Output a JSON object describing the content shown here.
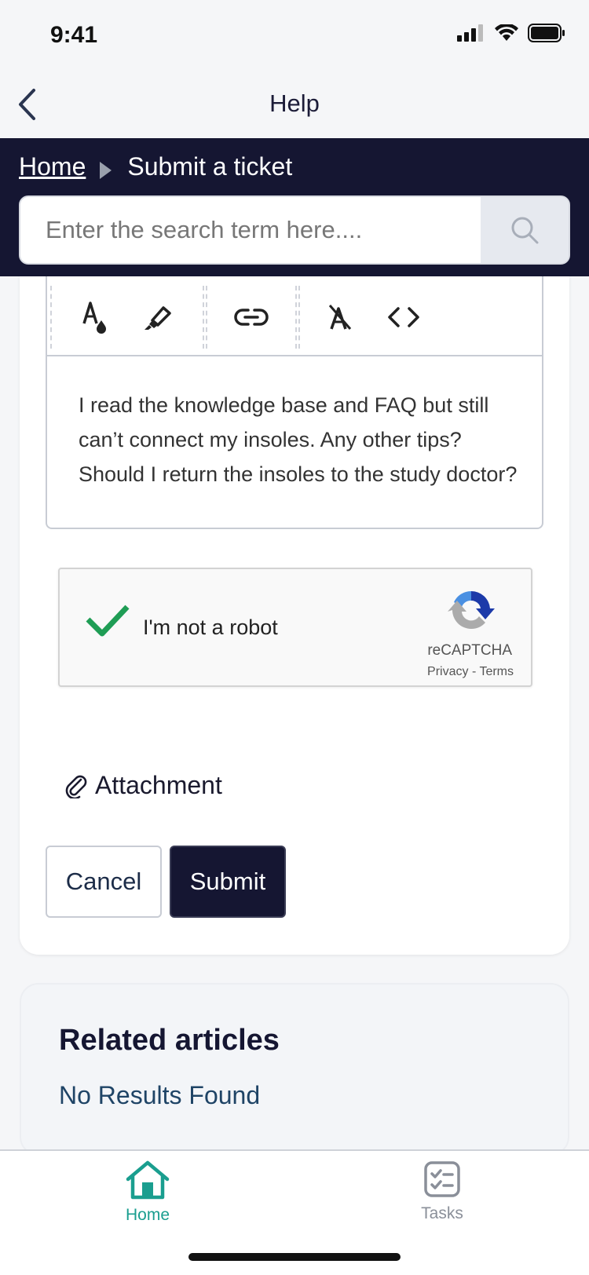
{
  "status_bar": {
    "time": "9:41"
  },
  "nav": {
    "title": "Help"
  },
  "breadcrumb": {
    "home": "Home",
    "current": "Submit a ticket"
  },
  "search": {
    "placeholder": "Enter the search term here...."
  },
  "editor": {
    "body_text": "I read the knowledge base and FAQ but still can’t connect my insoles. Any other tips? Should I return the insoles to the study doctor?"
  },
  "captcha": {
    "label": "I'm not a robot",
    "brand": "reCAPTCHA",
    "privacy": "Privacy",
    "separator": "-",
    "terms": "Terms",
    "checked": true
  },
  "attachment": {
    "label": "Attachment"
  },
  "actions": {
    "cancel": "Cancel",
    "submit": "Submit"
  },
  "related": {
    "title": "Related articles",
    "empty": "No Results Found"
  },
  "tabbar": {
    "home": "Home",
    "tasks": "Tasks",
    "active_color": "#1a9e8f",
    "inactive_color": "#8a8f99"
  }
}
